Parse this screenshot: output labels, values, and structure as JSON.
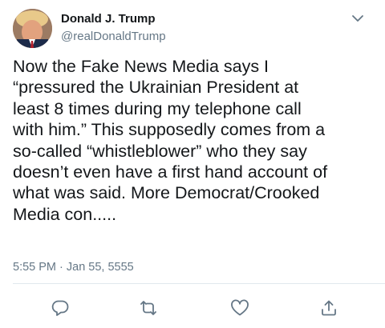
{
  "author": {
    "name": "Donald J. Trump",
    "handle": "@realDonaldTrump"
  },
  "tweet": {
    "text": "Now the Fake News Media says I\n“pressured the Ukrainian President at\nleast 8 times during my telephone call\nwith him.” This supposedly comes from a\nso-called “whistleblower” who they say\ndoesn’t even have a first hand account of\nwhat was said. More Democrat/Crooked\nMedia con.....",
    "timestamp": "5:55 PM · Jan 55, 5555"
  },
  "icons": {
    "menu": "chevron-down-icon",
    "reply": "reply-icon",
    "retweet": "retweet-icon",
    "like": "heart-icon",
    "share": "share-icon"
  },
  "colors": {
    "text": "#14171a",
    "secondary": "#657786",
    "icon": "#657786",
    "divider": "#e1e8ed"
  }
}
